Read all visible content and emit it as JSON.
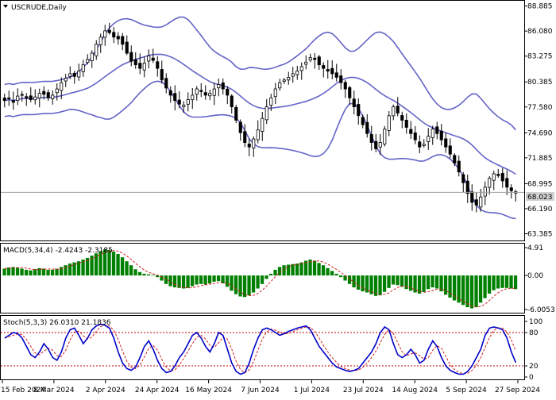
{
  "window": {
    "title": "USCRUDE,Daily",
    "dropdown_icon": "triangle-down-icon"
  },
  "colors": {
    "candle": "#000000",
    "bollinger": "#6464c8",
    "macd_bar": "#008000",
    "macd_signal": "#d02020",
    "stoch_main": "#0000c8",
    "stoch_signal": "#d02020",
    "level_line": "#c00000",
    "price_line": "#a0a0a0",
    "price_label_bg": "#d0d0d0",
    "frame": "#000000"
  },
  "price_panel": {
    "current_price_label": "68.023",
    "current_price": 68.023,
    "axis_labels": [
      "88.885",
      "86.080",
      "83.275",
      "80.385",
      "77.580",
      "74.690",
      "71.885",
      "68.995",
      "66.190",
      "63.385"
    ]
  },
  "macd_panel": {
    "label": "MACD(5,34,4) -2.4243 -2.3185",
    "axis_labels": [
      "4.91",
      "0.00",
      "-6.0053"
    ]
  },
  "stoch_panel": {
    "label": "Stoch(5,3,3) 26.0310 21.1836",
    "axis_labels": [
      "100",
      "80",
      "20",
      "0"
    ],
    "levels": [
      80,
      20
    ]
  },
  "x_axis": {
    "labels": [
      "15 Feb 2024",
      "8 Mar 2024",
      "2 Apr 2024",
      "24 Apr 2024",
      "16 May 2024",
      "7 Jun 2024",
      "1 Jul 2024",
      "23 Jul 2024",
      "14 Aug 2024",
      "5 Sep 2024",
      "27 Sep 2024"
    ]
  },
  "chart_data": [
    {
      "type": "candlestick",
      "title": "USCRUDE,Daily",
      "ylim": [
        63.385,
        88.885
      ],
      "x": [
        "15 Feb 2024",
        "8 Mar 2024",
        "2 Apr 2024",
        "24 Apr 2024",
        "16 May 2024",
        "7 Jun 2024",
        "1 Jul 2024",
        "23 Jul 2024",
        "14 Aug 2024",
        "5 Sep 2024",
        "27 Sep 2024"
      ],
      "close_path": [
        78.3,
        78.5,
        78.1,
        78.8,
        78.9,
        78.6,
        78.4,
        78.7,
        79.1,
        79.0,
        78.6,
        78.9,
        79.6,
        80.3,
        80.8,
        81.3,
        81.0,
        81.6,
        82.3,
        82.9,
        83.6,
        84.6,
        85.4,
        86.1,
        85.9,
        85.4,
        85.2,
        84.6,
        83.6,
        82.7,
        82.3,
        81.9,
        82.5,
        83.3,
        82.8,
        81.9,
        80.6,
        79.7,
        78.9,
        78.3,
        77.9,
        77.8,
        78.4,
        78.9,
        79.6,
        79.3,
        78.9,
        79.1,
        79.6,
        80.1,
        79.6,
        78.9,
        77.6,
        76.1,
        74.7,
        73.6,
        73.1,
        74.0,
        75.0,
        76.3,
        77.6,
        78.6,
        79.6,
        80.3,
        80.6,
        80.9,
        81.3,
        81.6,
        82.1,
        82.6,
        83.1,
        82.9,
        82.3,
        81.9,
        81.6,
        81.3,
        80.9,
        80.3,
        79.6,
        78.6,
        77.6,
        76.6,
        75.6,
        74.6,
        73.6,
        72.9,
        73.6,
        75.1,
        76.6,
        77.6,
        76.9,
        76.1,
        75.3,
        74.6,
        73.9,
        73.1,
        73.4,
        74.3,
        75.1,
        74.6,
        73.9,
        73.1,
        72.3,
        71.3,
        70.3,
        69.1,
        67.9,
        66.9,
        66.6,
        67.5,
        68.6,
        69.6,
        70.1,
        69.9,
        69.3,
        68.6,
        68.2,
        68.1
      ]
    },
    {
      "type": "bar",
      "title": "MACD(5,34,4) -2.4243 -2.3185",
      "ylim": [
        -6.0053,
        4.91
      ],
      "values": [
        1.2,
        1.4,
        1.5,
        1.4,
        1.2,
        1.0,
        0.9,
        1.1,
        1.3,
        1.2,
        1.0,
        1.0,
        1.2,
        1.5,
        1.8,
        2.1,
        2.3,
        2.5,
        2.8,
        3.1,
        3.5,
        3.9,
        4.3,
        4.6,
        4.5,
        4.2,
        3.8,
        3.2,
        2.5,
        1.8,
        1.1,
        0.6,
        0.3,
        0.2,
        0.1,
        -0.3,
        -0.9,
        -1.5,
        -1.9,
        -2.1,
        -2.2,
        -2.3,
        -2.2,
        -1.9,
        -1.6,
        -1.5,
        -1.6,
        -1.4,
        -1.1,
        -1.0,
        -1.4,
        -2.0,
        -2.7,
        -3.3,
        -3.7,
        -3.8,
        -3.5,
        -3.0,
        -2.3,
        -1.5,
        -0.6,
        0.3,
        1.0,
        1.5,
        1.8,
        1.9,
        2.0,
        2.1,
        2.3,
        2.6,
        2.8,
        2.6,
        2.2,
        1.8,
        1.3,
        0.8,
        0.3,
        -0.3,
        -0.9,
        -1.5,
        -2.1,
        -2.5,
        -2.8,
        -3.0,
        -3.3,
        -3.6,
        -3.5,
        -2.9,
        -2.2,
        -1.6,
        -1.7,
        -2.0,
        -2.4,
        -2.7,
        -3.0,
        -3.2,
        -2.9,
        -2.4,
        -2.1,
        -2.3,
        -2.8,
        -3.4,
        -3.9,
        -4.4,
        -4.8,
        -5.2,
        -5.6,
        -5.8,
        -5.6,
        -4.8,
        -4.0,
        -3.2,
        -2.6,
        -2.3,
        -2.2,
        -2.2,
        -2.3,
        -2.4
      ]
    },
    {
      "type": "line",
      "title": "Stoch(5,3,3) 26.0310 21.1836",
      "ylim": [
        0,
        100
      ],
      "series": [
        {
          "values": [
            70,
            75,
            80,
            78,
            70,
            55,
            40,
            35,
            45,
            60,
            50,
            35,
            30,
            45,
            70,
            85,
            88,
            75,
            60,
            70,
            85,
            92,
            95,
            93,
            88,
            70,
            45,
            25,
            15,
            12,
            18,
            35,
            55,
            65,
            50,
            30,
            15,
            8,
            10,
            20,
            35,
            45,
            60,
            75,
            80,
            70,
            55,
            45,
            60,
            80,
            75,
            50,
            25,
            10,
            5,
            8,
            25,
            50,
            70,
            85,
            88,
            85,
            80,
            75,
            78,
            82,
            85,
            88,
            90,
            92,
            85,
            70,
            55,
            45,
            35,
            25,
            18,
            15,
            12,
            10,
            12,
            15,
            25,
            35,
            45,
            60,
            80,
            90,
            85,
            60,
            40,
            35,
            40,
            50,
            40,
            25,
            30,
            50,
            65,
            55,
            35,
            20,
            12,
            8,
            5,
            5,
            10,
            20,
            35,
            50,
            75,
            88,
            90,
            88,
            85,
            70,
            45,
            26
          ]
        }
      ]
    }
  ]
}
